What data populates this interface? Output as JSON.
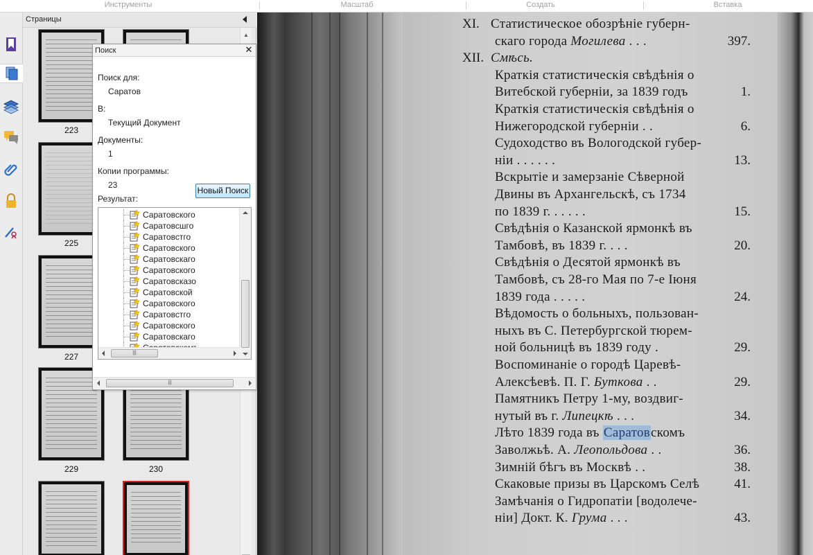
{
  "toolbar": {
    "groups": [
      "Инструменты",
      "Масштаб",
      "Создать",
      "Вставка"
    ]
  },
  "rail": {
    "icons": [
      "bookmark-icon",
      "pages-icon",
      "layers-icon",
      "comments-icon",
      "attachments-icon",
      "security-icon",
      "signatures-icon"
    ]
  },
  "pages_panel": {
    "title": "Страницы",
    "thumbnails": [
      {
        "label": "223"
      },
      {
        "label": "225"
      },
      {
        "label": "227"
      },
      {
        "label": "229"
      },
      {
        "label": "230"
      }
    ]
  },
  "search": {
    "title": "Поиск",
    "close": "✕",
    "search_for_label": "Поиск для:",
    "search_for_value": "Саратов",
    "in_label": "В:",
    "in_value": "Текущий Документ",
    "documents_label": "Документы:",
    "documents_value": "1",
    "copies_label": "Копии программы:",
    "copies_value": "23",
    "new_search_button": "Новый Поиск",
    "results_label": "Результат:",
    "results": [
      "Саратовского",
      "Саратовсшго",
      "Саратовстго",
      "Саратовского",
      "Саратовскаго",
      "Саратовского",
      "Саратовсказо",
      "Саратовской",
      "Саратовского",
      "Саратовстго",
      "Саратовского",
      "Саратовскаго",
      "Саратовскомъ"
    ]
  },
  "document": {
    "entries": [
      {
        "roman": "XI.",
        "text": "Статистическое обозрѣніе губерн-"
      },
      {
        "text_a": "скаго города ",
        "italic": "Могилева",
        "dots": "  .   .   .",
        "num": "397."
      },
      {
        "roman": "XII.",
        "italic_heading": "Смѣсь."
      },
      {
        "text": "Краткія статистическія свѣдѣнія о"
      },
      {
        "text": "Витебской губерніи, за 1839 годъ",
        "num": "1."
      },
      {
        "text": "Краткія статистическія свѣдѣнія о"
      },
      {
        "text": "Нижегородской губерніи    .    .",
        "num": "6."
      },
      {
        "text": "Судоходство въ Вологодской губер-"
      },
      {
        "text": "ніи     .     .     .     .     .     .",
        "num": "13."
      },
      {
        "text": "Вскрытіе и замерзаніе Сѣверной"
      },
      {
        "text": "Двины въ Архангельскѣ, съ 1734"
      },
      {
        "text": "по 1839 г.     .     .     .     .     .",
        "num": "15."
      },
      {
        "text": "Свѣдѣнія о Казанской ярмонкѣ въ"
      },
      {
        "text": "Тамбовѣ, въ 1839 г.    .    .    .",
        "num": "20."
      },
      {
        "text": "Свѣдѣнія о Десятой ярмонкѣ въ"
      },
      {
        "text": "Тамбовѣ, съ 28-го Мая по 7-е Іюня"
      },
      {
        "text": "1839 года    .     .     .     .     .",
        "num": "24."
      },
      {
        "text": "Вѣдомость о больныхъ, пользован-"
      },
      {
        "text": "ныхъ въ С. Петербургской тюрем-"
      },
      {
        "text": "ной больницѣ въ 1839 году    .",
        "num": "29."
      },
      {
        "text": "Воспоминаніе о городѣ Царевѣ-"
      },
      {
        "text_a": "Алексѣевѣ. П. Г. ",
        "italic": "Буткова",
        "dots": "  .   .",
        "num": "29."
      },
      {
        "text": "Памятникъ Петру 1-му, воздвиг-"
      },
      {
        "text_a": "нутый въ г. ",
        "italic": "Липецкѣ",
        "dots": "   .   .   .",
        "num": "34."
      },
      {
        "text_a": "Лѣто 1839 года въ ",
        "highlight": "Саратов",
        "text_b": "скомъ"
      },
      {
        "text_a": "Заволжьѣ. А. ",
        "italic": "Леопольдова",
        "dots": " .   .",
        "num": "36."
      },
      {
        "text": "Зимній бѣгъ въ Москвѣ    .    .",
        "num": "38."
      },
      {
        "text": "Скаковые призы въ Царскомъ Селѣ",
        "num": "41."
      },
      {
        "text": "Замѣчанія о Гидропатіи [водолече-"
      },
      {
        "text_a": "ніи] Докт. К. ",
        "italic": "Грума",
        "dots": "  .   .   .",
        "num": "43."
      }
    ]
  },
  "colors": {
    "highlight": "#78aadc",
    "selected_thumb_border": "#e21b1b",
    "button_border": "#3c7fb1"
  }
}
